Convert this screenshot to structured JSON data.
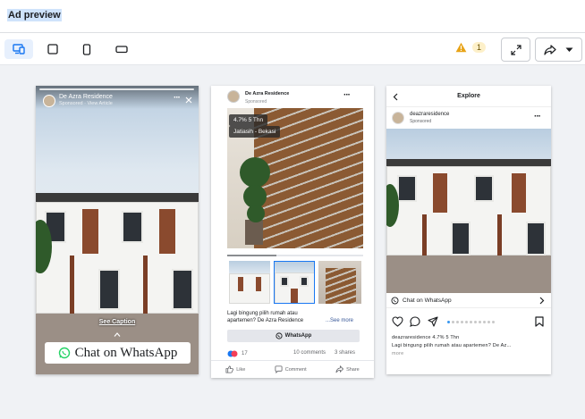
{
  "header": {
    "title": "Ad preview"
  },
  "toolbar": {
    "warning_count": "1",
    "colors": {
      "active_bg": "#e7f0fd",
      "accent": "#1877f2",
      "warning": "#e8a317"
    }
  },
  "story": {
    "page_name": "De Azra Residence",
    "sponsored": "Sponsored · View Article",
    "see_caption": "See Caption",
    "cta": "Chat on WhatsApp"
  },
  "feed": {
    "page_name": "De Azra Residence",
    "sponsored": "Sponsored",
    "tag_rate": "4.7% 5 Thn",
    "tag_location": "Jatiasih - Bekasi",
    "caption_line1": "Lagi bingung pilih rumah atau",
    "caption_line2": "apartemen? De Azra Residence",
    "see_more": "...See more",
    "cta": "WhatsApp",
    "reactions": "17",
    "comments": "10 comments",
    "shares": "3 shares",
    "actions": {
      "like": "Like",
      "comment": "Comment",
      "share": "Share"
    }
  },
  "instagram": {
    "header": "Explore",
    "username": "deazraresidence",
    "sponsored": "Sponsored",
    "cta": "Chat on WhatsApp",
    "caption_line1": "deazraresidence 4.7% 5 Thn",
    "caption_line2": "Lagi bingung pilih rumah atau apartemen? De Az...",
    "more": "more"
  }
}
